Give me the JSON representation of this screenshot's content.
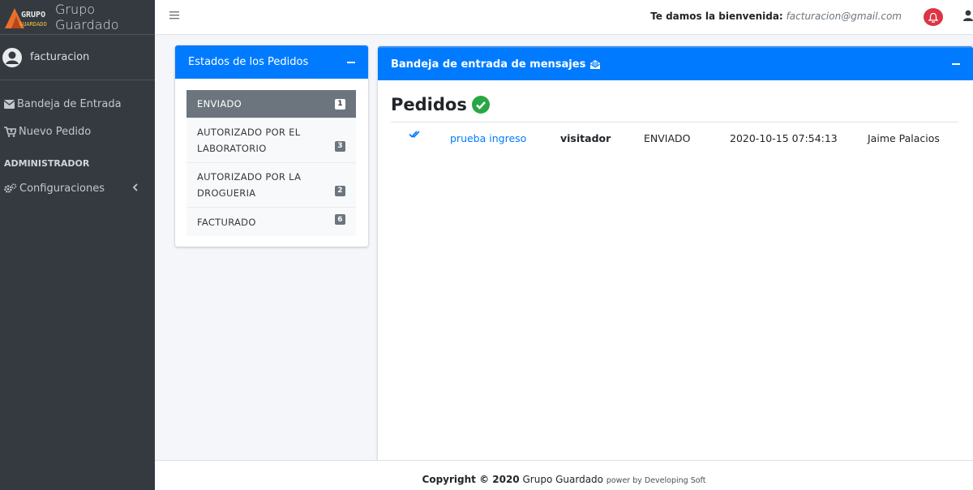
{
  "brand": {
    "logo_text": "GRUPO GUARDADO",
    "name": "Grupo Guardado"
  },
  "user": {
    "name": "facturacion"
  },
  "sidebar": {
    "items": [
      {
        "label": "Bandeja de Entrada",
        "icon": "envelope-icon"
      },
      {
        "label": "Nuevo Pedido",
        "icon": "cart-plus-icon"
      }
    ],
    "section_header": "ADMINISTRADOR",
    "config": {
      "label": "Configuraciones",
      "icon": "cogs-icon"
    }
  },
  "topbar": {
    "welcome_label": "Te damos la bienvenida:",
    "email": "facturacion@gmail.com"
  },
  "estados": {
    "title": "Estados de los Pedidos",
    "items": [
      {
        "line1": "ENVIADO",
        "line2": "",
        "count": "1",
        "active": true
      },
      {
        "line1": "AUTORIZADO POR EL",
        "line2": "LABORATORIO",
        "count": "3",
        "active": false
      },
      {
        "line1": "AUTORIZADO POR LA",
        "line2": "DROGUERIA",
        "count": "2",
        "active": false
      },
      {
        "line1": "FACTURADO",
        "line2": "",
        "count": "6",
        "active": false
      }
    ]
  },
  "bandeja": {
    "title": "Bandeja de entrada de mensajes",
    "section_title": "Pedidos",
    "rows": [
      {
        "subject": "prueba ingreso",
        "role": "visitador",
        "status": "ENVIADO",
        "date": "2020-10-15 07:54:13",
        "person": "Jaime Palacios"
      }
    ]
  },
  "footer": {
    "copyright": "Copyright © 2020",
    "company": "Grupo Guardado",
    "powered": "power by Developing Soft"
  },
  "colors": {
    "primary": "#007bff",
    "sidebar": "#343a40",
    "success": "#28a745",
    "danger": "#dc3545"
  }
}
